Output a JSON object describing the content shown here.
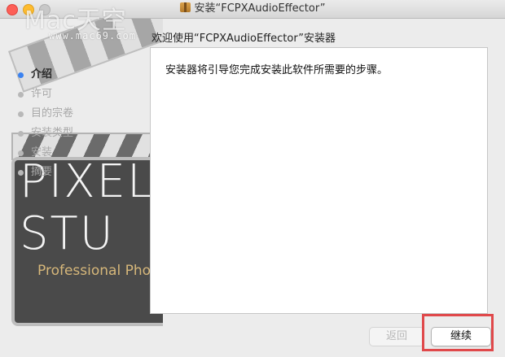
{
  "window": {
    "title": "安装“FCPXAudioEffector”",
    "icon": "package-icon"
  },
  "watermark": {
    "brand": "Mac天空",
    "url": "www.mac69.com"
  },
  "artwork": {
    "line1": "PIXEL",
    "line2": "STU",
    "line3": "Professional Pho"
  },
  "steps": [
    {
      "label": "介绍",
      "active": true
    },
    {
      "label": "许可",
      "active": false
    },
    {
      "label": "目的宗卷",
      "active": false
    },
    {
      "label": "安装类型",
      "active": false
    },
    {
      "label": "安装",
      "active": false
    },
    {
      "label": "摘要",
      "active": false
    }
  ],
  "header": {
    "text": "欢迎使用“FCPXAudioEffector”安装器"
  },
  "content": {
    "body": "安装器将引导您完成安装此软件所需要的步骤。"
  },
  "buttons": {
    "back": "返回",
    "continue": "继续"
  },
  "colors": {
    "active_step_dot": "#3b82f0",
    "highlight_border": "#e0494b"
  }
}
